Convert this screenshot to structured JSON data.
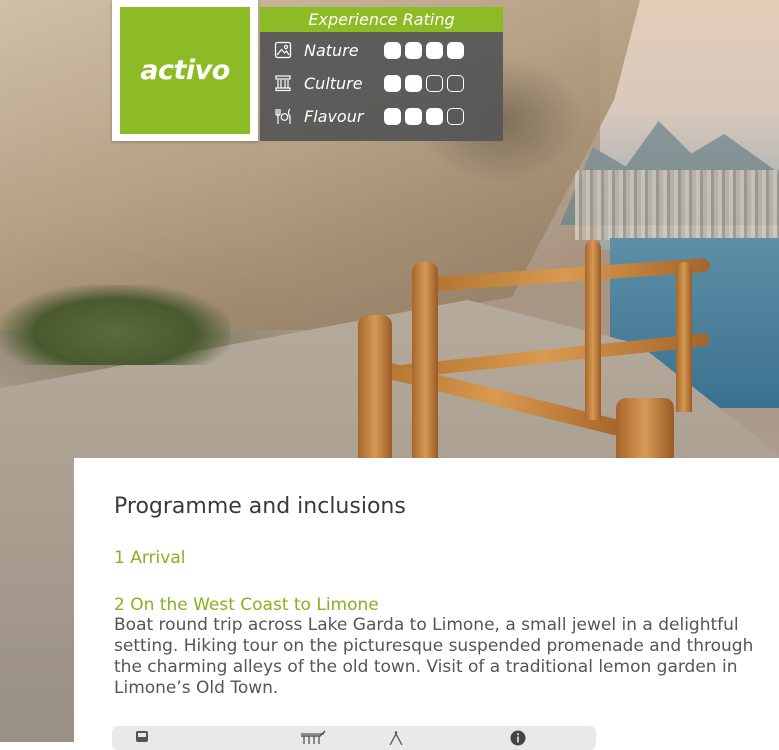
{
  "brand": {
    "logo_text": "activo",
    "accent_color": "#8dbb25"
  },
  "rating": {
    "title": "Experience Rating",
    "items": [
      {
        "label": "Nature",
        "icon": "landscape-icon",
        "score": 4,
        "max": 4
      },
      {
        "label": "Culture",
        "icon": "temple-icon",
        "score": 2,
        "max": 4
      },
      {
        "label": "Flavour",
        "icon": "dining-icon",
        "score": 3,
        "max": 4
      }
    ]
  },
  "programme": {
    "heading": "Programme and inclusions",
    "days": [
      {
        "title": "1 Arrival"
      },
      {
        "title": "2 On the West Coast to Limone",
        "description": "Boat round trip across Lake Garda to Limone, a small jewel in a delightful setting. Hiking tour on the picturesque suspended promenade and through the charming alleys of the old town. Visit of a traditional lemon garden in Limone’s Old Town."
      }
    ],
    "feature_icons": [
      "bus-icon",
      "boat-icon",
      "hiking-icon",
      "info-icon"
    ]
  }
}
